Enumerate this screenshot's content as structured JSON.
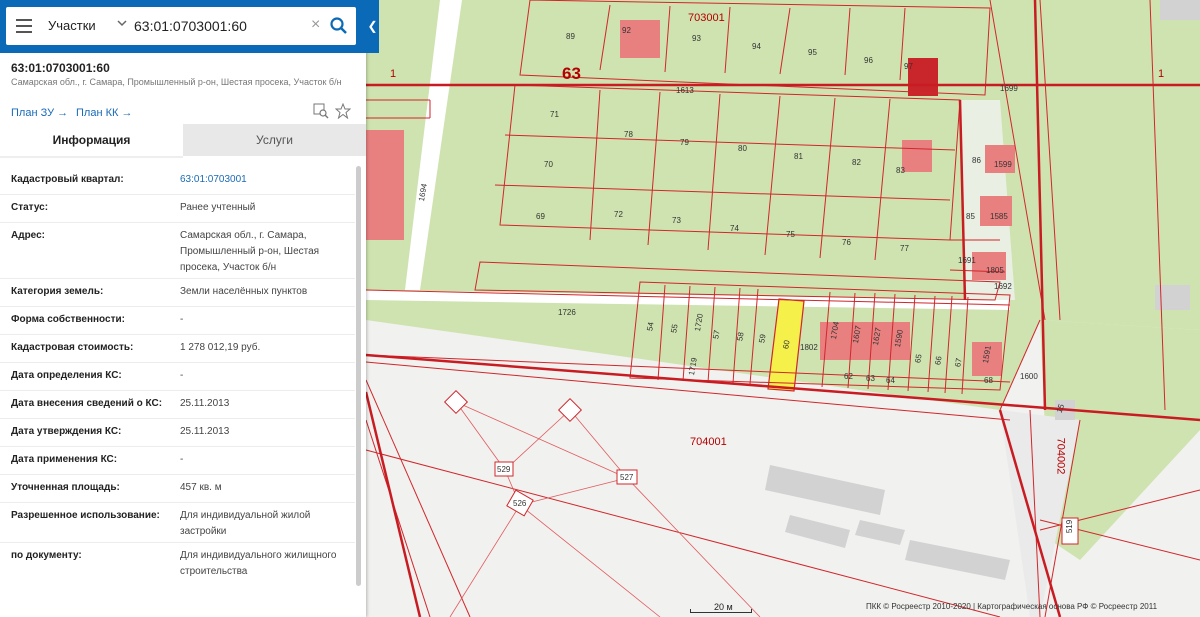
{
  "search": {
    "type_label": "Участки",
    "query": "63:01:0703001:60",
    "clear_glyph": "×"
  },
  "object": {
    "number": "63:01:0703001:60",
    "address": "Самарская обл., г. Самара, Промышленный р-он, Шестая просека, Участок б/н"
  },
  "links": {
    "plan_zu": "План ЗУ",
    "plan_kk": "План КК"
  },
  "tabs": {
    "info": "Информация",
    "services": "Услуги"
  },
  "info_rows": [
    {
      "label": "Кадастровый квартал:",
      "value": "63:01:0703001"
    },
    {
      "label": "Статус:",
      "value": "Ранее учтенный"
    },
    {
      "label": "Адрес:",
      "value": "Самарская обл., г. Самара, Промышленный р-он, Шестая просека, Участок б/н"
    },
    {
      "label": "Категория земель:",
      "value": "Земли населённых пунктов"
    },
    {
      "label": "Форма собственности:",
      "value": "-"
    },
    {
      "label": "Кадастровая стоимость:",
      "value": "1 278 012,19 руб."
    },
    {
      "label": "Дата определения КС:",
      "value": "-"
    },
    {
      "label": "Дата внесения сведений о КС:",
      "value": "25.11.2013"
    },
    {
      "label": "Дата утверждения КС:",
      "value": "25.11.2013"
    },
    {
      "label": "Дата применения КС:",
      "value": "-"
    },
    {
      "label": "Уточненная площадь:",
      "value": "457 кв. м"
    },
    {
      "label": "Разрешенное использование:",
      "value": "Для индивидуальной жилой застройки"
    },
    {
      "label": "по документу:",
      "value": "Для индивидуального жилищного строительства"
    }
  ],
  "map": {
    "scale_label": "20 м",
    "attribution": "ПКК © Росреестр 2010-2020 | Картографическая основа РФ © Росреестр 2011",
    "labels": {
      "district": "63",
      "block_north": "703001",
      "block_south": "704001",
      "block_east": "704002",
      "n1": "1",
      "n1b": "1",
      "p89": "89",
      "p92": "92",
      "p93": "93",
      "p94": "94",
      "p95": "95",
      "p96": "96",
      "p97": "97",
      "p1613": "1613",
      "p1699": "1699",
      "p71": "71",
      "p78": "78",
      "p79": "79",
      "p80": "80",
      "p81": "81",
      "p82": "82",
      "p83": "83",
      "p86": "86",
      "p1599": "1599",
      "p70": "70",
      "p69": "69",
      "p72": "72",
      "p73": "73",
      "p74": "74",
      "p75": "75",
      "p76": "76",
      "p77": "77",
      "p85": "85",
      "p1585": "1585",
      "p1691": "1691",
      "p1805": "1805",
      "p1692": "1692",
      "p1694": "1694",
      "p1726": "1726",
      "p54": "54",
      "p55": "55",
      "p1720": "1720",
      "p57": "57",
      "p58": "58",
      "p59": "59",
      "p60": "60",
      "p1802": "1802",
      "p1704": "1704",
      "p1607": "1607",
      "p1627": "1627",
      "p1590": "1590",
      "p65": "65",
      "p66": "66",
      "p67": "67",
      "p1591": "1591",
      "p62": "62",
      "p63": "63",
      "p64": "64",
      "p68": "68",
      "p1600": "1600",
      "p1719": "1719",
      "p15": "15",
      "t529": "529",
      "t527": "527",
      "t526": "526",
      "t519": "519"
    },
    "colors": {
      "parcel_fill": "#cfe3b0",
      "boundary": "#d1262b",
      "building": "#e88080",
      "selected": "#f5f04a",
      "road": "#ffffff",
      "accent": "#0b6ab7"
    }
  }
}
